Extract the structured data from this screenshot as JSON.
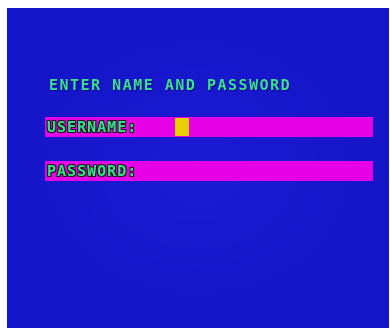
{
  "screen": {
    "title": "ENTER NAME AND PASSWORD",
    "username": {
      "label": "USERNAME:",
      "value": ""
    },
    "password": {
      "label": "PASSWORD:",
      "value": ""
    }
  },
  "colors": {
    "background": "#1414c8",
    "text": "#3ce08c",
    "field": "#e600e6",
    "cursor": "#e6d000"
  }
}
